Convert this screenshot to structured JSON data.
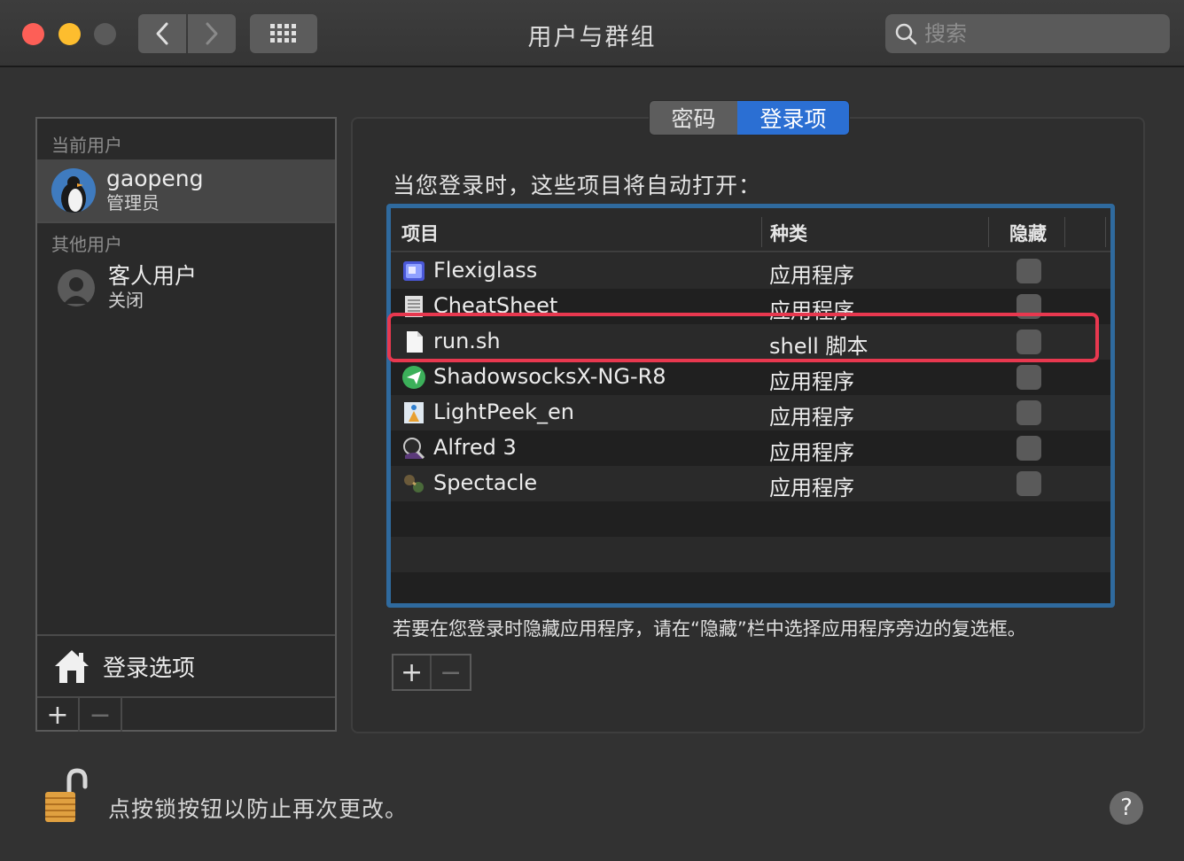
{
  "window": {
    "title": "用户与群组",
    "search_placeholder": "搜索"
  },
  "sidebar": {
    "current_user_header": "当前用户",
    "current_user": {
      "name": "gaopeng",
      "role": "管理员"
    },
    "other_users_header": "其他用户",
    "other_users": [
      {
        "name": "客人用户",
        "status": "关闭"
      }
    ],
    "login_options_label": "登录选项",
    "add_label": "+",
    "remove_label": "−"
  },
  "tabs": [
    {
      "label": "密码",
      "selected": false
    },
    {
      "label": "登录项",
      "selected": true
    }
  ],
  "main": {
    "intro": "当您登录时，这些项目将自动打开：",
    "columns": {
      "item": "项目",
      "kind": "种类",
      "hide": "隐藏"
    },
    "items": [
      {
        "name": "Flexiglass",
        "kind": "应用程序",
        "icon": "flexiglass-icon",
        "hidden": false
      },
      {
        "name": "CheatSheet",
        "kind": "应用程序",
        "icon": "cheatsheet-icon",
        "hidden": false
      },
      {
        "name": "run.sh",
        "kind": "shell 脚本",
        "icon": "document-icon",
        "hidden": false
      },
      {
        "name": "ShadowsocksX-NG-R8",
        "kind": "应用程序",
        "icon": "shadowsocks-icon",
        "hidden": false
      },
      {
        "name": "LightPeek_en",
        "kind": "应用程序",
        "icon": "lightpeek-icon",
        "hidden": false
      },
      {
        "name": "Alfred 3",
        "kind": "应用程序",
        "icon": "alfred-icon",
        "hidden": false
      },
      {
        "name": "Spectacle",
        "kind": "应用程序",
        "icon": "spectacle-icon",
        "hidden": false
      }
    ],
    "hint": "若要在您登录时隐藏应用程序，请在“隐藏”栏中选择应用程序旁边的复选框。",
    "add_label": "+",
    "remove_label": "−"
  },
  "footer": {
    "lock_text": "点按锁按钮以防止再次更改。",
    "help_label": "?"
  },
  "colors": {
    "accent": "#2b6fd3",
    "table_border": "#2f6a9e",
    "highlight": "#e8384f"
  }
}
